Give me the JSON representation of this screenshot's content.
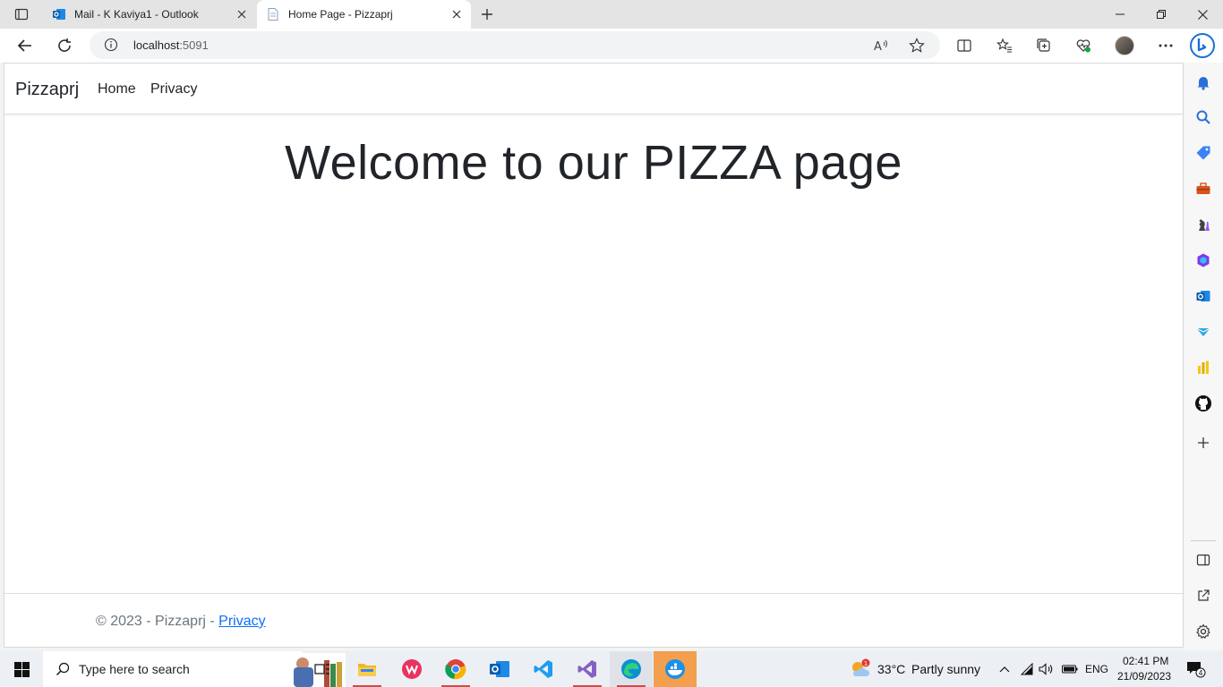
{
  "browser": {
    "tabs": [
      {
        "title": "Mail - K Kaviya1 - Outlook",
        "active": false
      },
      {
        "title": "Home Page - Pizzaprj",
        "active": true
      }
    ],
    "address": {
      "host": "localhost",
      "port": ":5091"
    }
  },
  "page": {
    "brand": "Pizzaprj",
    "nav": [
      "Home",
      "Privacy"
    ],
    "heading": "Welcome to our PIZZA page",
    "footer": {
      "prefix": "© 2023 - Pizzaprj - ",
      "link": "Privacy"
    }
  },
  "taskbar": {
    "search_placeholder": "Type here to search",
    "weather": {
      "temp": "33°C",
      "condition": "Partly sunny",
      "alert_count": "1"
    },
    "language": "ENG",
    "time": "02:41 PM",
    "date": "21/09/2023",
    "notification_count": "4"
  },
  "colors": {
    "link": "#0d6efd",
    "edge_accent": "#0a66c2",
    "running_app_underline": "#d24a4a"
  }
}
